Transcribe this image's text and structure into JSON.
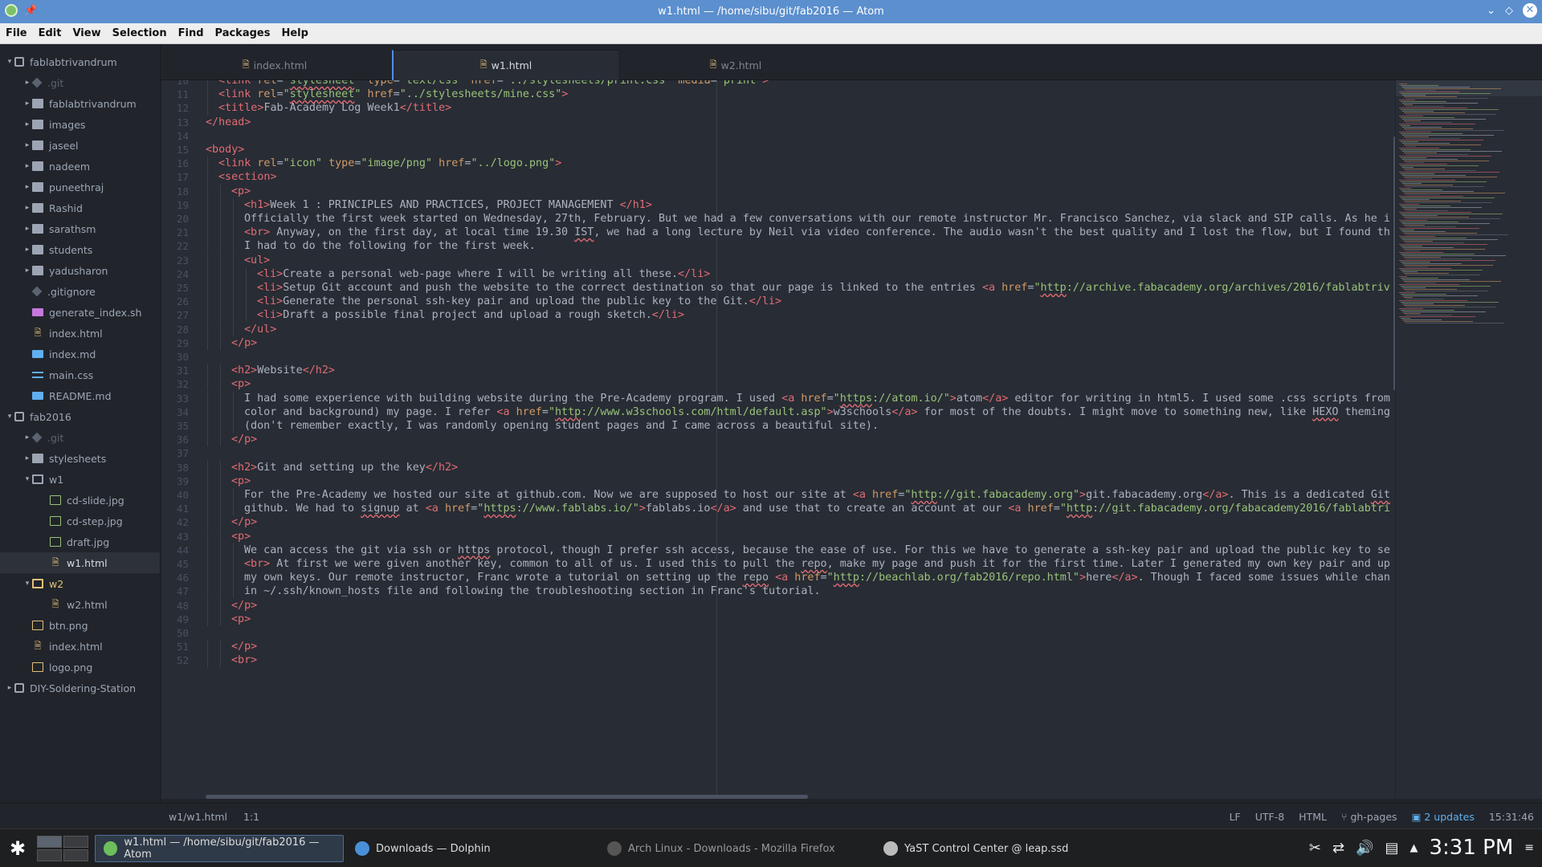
{
  "window": {
    "title": "w1.html — /home/sibu/git/fab2016 — Atom"
  },
  "menu": [
    "File",
    "Edit",
    "View",
    "Selection",
    "Find",
    "Packages",
    "Help"
  ],
  "tree": [
    {
      "label": "fablabtrivandrum",
      "type": "repo",
      "depth": 0,
      "arrow": "▾"
    },
    {
      "label": ".git",
      "type": "git",
      "depth": 1,
      "arrow": "▸",
      "dim": true
    },
    {
      "label": "fablabtrivandrum",
      "type": "folder",
      "depth": 1,
      "arrow": "▸"
    },
    {
      "label": "images",
      "type": "folder",
      "depth": 1,
      "arrow": "▸"
    },
    {
      "label": "jaseel",
      "type": "folder",
      "depth": 1,
      "arrow": "▸"
    },
    {
      "label": "nadeem",
      "type": "folder",
      "depth": 1,
      "arrow": "▸"
    },
    {
      "label": "puneethraj",
      "type": "folder",
      "depth": 1,
      "arrow": "▸"
    },
    {
      "label": "Rashid",
      "type": "folder",
      "depth": 1,
      "arrow": "▸"
    },
    {
      "label": "sarathsm",
      "type": "folder",
      "depth": 1,
      "arrow": "▸"
    },
    {
      "label": "students",
      "type": "folder",
      "depth": 1,
      "arrow": "▸"
    },
    {
      "label": "yadusharon",
      "type": "folder",
      "depth": 1,
      "arrow": "▸"
    },
    {
      "label": ".gitignore",
      "type": "git",
      "depth": 1,
      "arrow": ""
    },
    {
      "label": "generate_index.sh",
      "type": "sh",
      "depth": 1,
      "arrow": ""
    },
    {
      "label": "index.html",
      "type": "html",
      "depth": 1,
      "arrow": ""
    },
    {
      "label": "index.md",
      "type": "md",
      "depth": 1,
      "arrow": ""
    },
    {
      "label": "main.css",
      "type": "css",
      "depth": 1,
      "arrow": ""
    },
    {
      "label": "README.md",
      "type": "md",
      "depth": 1,
      "arrow": ""
    },
    {
      "label": "fab2016",
      "type": "repo",
      "depth": 0,
      "arrow": "▾"
    },
    {
      "label": ".git",
      "type": "git",
      "depth": 1,
      "arrow": "▸",
      "dim": true
    },
    {
      "label": "stylesheets",
      "type": "folder",
      "depth": 1,
      "arrow": "▸"
    },
    {
      "label": "w1",
      "type": "folder-open",
      "depth": 1,
      "arrow": "▾"
    },
    {
      "label": "cd-slide.jpg",
      "type": "img",
      "depth": 2,
      "arrow": ""
    },
    {
      "label": "cd-step.jpg",
      "type": "img",
      "depth": 2,
      "arrow": ""
    },
    {
      "label": "draft.jpg",
      "type": "img",
      "depth": 2,
      "arrow": ""
    },
    {
      "label": "w1.html",
      "type": "html",
      "depth": 2,
      "arrow": "",
      "selected": true
    },
    {
      "label": "w2",
      "type": "folder-open",
      "depth": 1,
      "arrow": "▾",
      "yellow": true
    },
    {
      "label": "w2.html",
      "type": "html",
      "depth": 2,
      "arrow": ""
    },
    {
      "label": "btn.png",
      "type": "imgy",
      "depth": 1,
      "arrow": ""
    },
    {
      "label": "index.html",
      "type": "html",
      "depth": 1,
      "arrow": ""
    },
    {
      "label": "logo.png",
      "type": "imgy",
      "depth": 1,
      "arrow": ""
    },
    {
      "label": "DIY-Soldering-Station",
      "type": "repo",
      "depth": 0,
      "arrow": "▸"
    }
  ],
  "tabs": [
    {
      "label": "index.html",
      "active": false
    },
    {
      "label": "w1.html",
      "active": true
    },
    {
      "label": "w2.html",
      "active": false
    }
  ],
  "code_lines": [
    {
      "n": "10",
      "html": "<span class='t'>&lt;link</span> <span class='a'>rel</span>=<span class='s'>\"<span class='u'>stylesheet</span>\"</span> <span class='a'>type</span>=<span class='s'>\"text/css\"</span> <span class='a'>href</span>=<span class='s'>\"../stylesheets/print.css\"</span> <span class='a'>media</span>=<span class='s'>\"print\"</span><span class='t'>&gt;</span>",
      "indent": 1
    },
    {
      "n": "11",
      "html": "<span class='t'>&lt;link</span> <span class='a'>rel</span>=<span class='s'>\"<span class='u'>stylesheet</span>\"</span> <span class='a'>href</span>=<span class='s'>\"../stylesheets/mine.css\"</span><span class='t'>&gt;</span>",
      "indent": 1
    },
    {
      "n": "12",
      "html": "<span class='t'>&lt;title&gt;</span>Fab-Academy Log Week1<span class='t'>&lt;/title&gt;</span>",
      "indent": 1
    },
    {
      "n": "13",
      "html": "<span class='t'>&lt;/head&gt;</span>",
      "indent": 0
    },
    {
      "n": "14",
      "html": "",
      "indent": 0
    },
    {
      "n": "15",
      "html": "<span class='t'>&lt;body&gt;</span>",
      "indent": 0
    },
    {
      "n": "16",
      "html": "<span class='t'>&lt;link</span> <span class='a'>rel</span>=<span class='s'>\"icon\"</span> <span class='a'>type</span>=<span class='s'>\"image/png\"</span> <span class='a'>href</span>=<span class='s'>\"../logo.png\"</span><span class='t'>&gt;</span>",
      "indent": 1
    },
    {
      "n": "17",
      "html": "<span class='t'>&lt;section&gt;</span>",
      "indent": 1
    },
    {
      "n": "18",
      "html": "<span class='t'>&lt;p&gt;</span>",
      "indent": 2
    },
    {
      "n": "19",
      "html": "<span class='t'>&lt;h1&gt;</span>Week 1 : PRINCIPLES AND PRACTICES, PROJECT MANAGEMENT <span class='t'>&lt;/h1&gt;</span>",
      "indent": 3
    },
    {
      "n": "20",
      "html": "Officially the first week started on Wednesday, 27th, February. But we had a few conversations with our remote instructor Mr. Francisco Sanchez, via slack and SIP calls. As he i",
      "indent": 3
    },
    {
      "n": "21",
      "html": "<span class='t'>&lt;br&gt;</span> Anyway, on the first day, at local time 19.30 <span class='u'>IST</span>, we had a long lecture by Neil via video conference. The audio wasn't the best quality and I lost the flow, but I found th",
      "indent": 3
    },
    {
      "n": "22",
      "html": "I had to do the following for the first week.",
      "indent": 3
    },
    {
      "n": "23",
      "html": "<span class='t'>&lt;ul&gt;</span>",
      "indent": 3
    },
    {
      "n": "24",
      "html": "<span class='t'>&lt;li&gt;</span>Create a personal web-page where I will be writing all these.<span class='t'>&lt;/li&gt;</span>",
      "indent": 4
    },
    {
      "n": "25",
      "html": "<span class='t'>&lt;li&gt;</span>Setup Git account and push the website to the correct destination so that our page is linked to the entries <span class='t'>&lt;a</span> <span class='a'>href</span>=<span class='s'>\"<span class='u'>http</span>://archive.fabacademy.org/archives/2016/fablabtriv</span>",
      "indent": 4
    },
    {
      "n": "26",
      "html": "<span class='t'>&lt;li&gt;</span>Generate the personal ssh-key pair and upload the public key to the Git.<span class='t'>&lt;/li&gt;</span>",
      "indent": 4
    },
    {
      "n": "27",
      "html": "<span class='t'>&lt;li&gt;</span>Draft a possible final project and upload a rough sketch.<span class='t'>&lt;/li&gt;</span>",
      "indent": 4
    },
    {
      "n": "28",
      "html": "<span class='t'>&lt;/ul&gt;</span>",
      "indent": 3
    },
    {
      "n": "29",
      "html": "<span class='t'>&lt;/p&gt;</span>",
      "indent": 2
    },
    {
      "n": "30",
      "html": "",
      "indent": 0
    },
    {
      "n": "31",
      "html": "<span class='t'>&lt;h2&gt;</span>Website<span class='t'>&lt;/h2&gt;</span>",
      "indent": 2
    },
    {
      "n": "32",
      "html": "<span class='t'>&lt;p&gt;</span>",
      "indent": 2
    },
    {
      "n": "33",
      "html": "I had some experience with building website during the Pre-Academy program. I used <span class='t'>&lt;a</span> <span class='a'>href</span>=<span class='s'>\"<span class='u'>https</span>://atom.io/\"</span><span class='t'>&gt;</span>atom<span class='t'>&lt;/a&gt;</span> editor for writing in html5. I used some .css scripts from",
      "indent": 3
    },
    {
      "n": "34",
      "html": "color and background) my page. I refer <span class='t'>&lt;a</span> <span class='a'>href</span>=<span class='s'>\"<span class='u'>http</span>://www.w3schools.com/html/default.asp\"</span><span class='t'>&gt;</span>w3schools<span class='t'>&lt;/a&gt;</span> for most of the doubts. I might move to something new, like <span class='u'>HEXO</span> theming",
      "indent": 3
    },
    {
      "n": "35",
      "html": "(don't remember exactly, I was randomly opening student pages and I came across a beautiful site).",
      "indent": 3
    },
    {
      "n": "36",
      "html": "<span class='t'>&lt;/p&gt;</span>",
      "indent": 2
    },
    {
      "n": "37",
      "html": "",
      "indent": 0
    },
    {
      "n": "38",
      "html": "<span class='t'>&lt;h2&gt;</span>Git and setting up the key<span class='t'>&lt;/h2&gt;</span>",
      "indent": 2
    },
    {
      "n": "39",
      "html": "<span class='t'>&lt;p&gt;</span>",
      "indent": 2
    },
    {
      "n": "40",
      "html": "For the Pre-Academy we hosted our site at github.com. Now we are supposed to host our site at <span class='t'>&lt;a</span> <span class='a'>href</span>=<span class='s'>\"<span class='u'>http</span>://git.fabacademy.org\"</span><span class='t'>&gt;</span>git.fabacademy.org<span class='t'>&lt;/a&gt;</span>. This is a dedicated <span class='u'>Git</span>",
      "indent": 3
    },
    {
      "n": "41",
      "html": "github. We had to <span class='u'>signup</span> at <span class='t'>&lt;a</span> <span class='a'>href</span>=<span class='s'>\"<span class='u'>https</span>://www.fablabs.io/\"</span><span class='t'>&gt;</span>fablabs.io<span class='t'>&lt;/a&gt;</span> and use that to create an account at our <span class='t'>&lt;a</span> <span class='a'>href</span>=<span class='s'>\"<span class='u'>http</span>://git.fabacademy.org/fabacademy2016/fablabtri</span>",
      "indent": 3
    },
    {
      "n": "42",
      "html": "<span class='t'>&lt;/p&gt;</span>",
      "indent": 2
    },
    {
      "n": "43",
      "html": "<span class='t'>&lt;p&gt;</span>",
      "indent": 2
    },
    {
      "n": "44",
      "html": "We can access the git via ssh or <span class='u'>https</span> protocol, though I prefer ssh access, because the ease of use. For this we have to generate a ssh-key pair and upload the public key to se",
      "indent": 3
    },
    {
      "n": "45",
      "html": "<span class='t'>&lt;br&gt;</span> At first we were given another key, common to all of us. I used this to pull the <span class='u'>repo</span>, make my page and push it for the first time. Later I generated my own key pair and up",
      "indent": 3
    },
    {
      "n": "46",
      "html": "my own keys. Our remote instructor, Franc wrote a tutorial on setting up the <span class='u'>repo</span> <span class='t'>&lt;a</span> <span class='a'>href</span>=<span class='s'>\"<span class='u'>http</span>://beachlab.org/fab2016/repo.html\"</span><span class='t'>&gt;</span>here<span class='t'>&lt;/a&gt;</span>. Though I faced some issues while chan",
      "indent": 3
    },
    {
      "n": "47",
      "html": "in ~/.ssh/known_hosts file and following the troubleshooting section in Franc's tutorial.",
      "indent": 3
    },
    {
      "n": "48",
      "html": "<span class='t'>&lt;/p&gt;</span>",
      "indent": 2
    },
    {
      "n": "49",
      "html": "<span class='t'>&lt;p&gt;</span>",
      "indent": 2
    },
    {
      "n": "50",
      "html": "",
      "indent": 0
    },
    {
      "n": "51",
      "html": "<span class='t'>&lt;/p&gt;</span>",
      "indent": 2
    },
    {
      "n": "52",
      "html": "<span class='t'>&lt;br&gt;</span>",
      "indent": 2
    }
  ],
  "status": {
    "path": "w1/w1.html",
    "cursor": "1:1",
    "line_ending": "LF",
    "encoding": "UTF-8",
    "grammar": "HTML",
    "branch": "gh-pages",
    "updates": "2 updates",
    "time": "15:31:46"
  },
  "taskbar": {
    "tasks": [
      {
        "label": "w1.html — /home/sibu/git/fab2016 — Atom",
        "active": true,
        "color": "#6cbf5b"
      },
      {
        "label": "Downloads — Dolphin",
        "active": false,
        "color": "#4a90d9"
      },
      {
        "label": "Arch Linux - Downloads - Mozilla Firefox",
        "active": false,
        "color": "#555555",
        "dim": true
      },
      {
        "label": "YaST Control Center @ leap.ssd",
        "active": false,
        "color": "#bbbbbb"
      }
    ],
    "clock": "3:31 PM"
  },
  "colors": {
    "accent": "#528bff",
    "titlebar": "#5b8fce",
    "editor_bg": "#282c34",
    "tag": "#e06c75",
    "attr": "#d19a66",
    "string": "#98c379"
  }
}
